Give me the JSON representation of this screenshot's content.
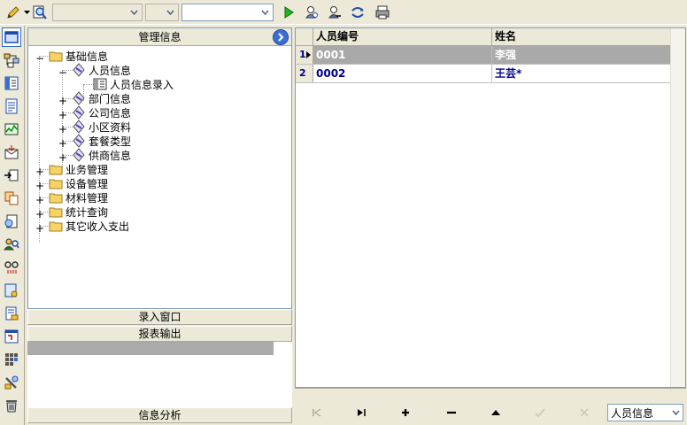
{
  "toolbar": {
    "buttons": [
      {
        "name": "pencil-edit-icon"
      },
      {
        "name": "find-magnifier-icon"
      },
      {
        "name": "run-play-icon"
      },
      {
        "name": "users-search-icon"
      },
      {
        "name": "user-filter-icon"
      },
      {
        "name": "refresh-swap-icon"
      },
      {
        "name": "printer-icon"
      }
    ],
    "combo1_value": "",
    "combo2_value": "",
    "combo3_value": ""
  },
  "tree_panel": {
    "title": "管理信息",
    "nodes": [
      {
        "label": "基础信息",
        "expanded": true,
        "level": 0,
        "icon": "folder-icon"
      },
      {
        "label": "人员信息",
        "expanded": true,
        "level": 1,
        "icon": "diamond-node-icon"
      },
      {
        "label": "人员信息录入",
        "level": 2,
        "icon": "form-icon"
      },
      {
        "label": "部门信息",
        "expanded": false,
        "level": 1,
        "icon": "diamond-node-icon"
      },
      {
        "label": "公司信息",
        "expanded": false,
        "level": 1,
        "icon": "diamond-node-icon"
      },
      {
        "label": "小区资料",
        "expanded": false,
        "level": 1,
        "icon": "diamond-node-icon"
      },
      {
        "label": "套餐类型",
        "expanded": false,
        "level": 1,
        "icon": "diamond-node-icon"
      },
      {
        "label": "供商信息",
        "expanded": false,
        "level": 1,
        "icon": "diamond-node-icon"
      },
      {
        "label": "业务管理",
        "expanded": false,
        "level": 0,
        "icon": "folder-icon"
      },
      {
        "label": "设备管理",
        "expanded": false,
        "level": 0,
        "icon": "folder-icon"
      },
      {
        "label": "材料管理",
        "expanded": false,
        "level": 0,
        "icon": "folder-icon"
      },
      {
        "label": "统计查询",
        "expanded": false,
        "level": 0,
        "icon": "folder-icon"
      },
      {
        "label": "其它收入支出",
        "expanded": false,
        "level": 0,
        "icon": "folder-icon"
      }
    ]
  },
  "outlook": {
    "bar1": "录入窗口",
    "bar2": "报表输出",
    "bar3": "信息分析"
  },
  "grid": {
    "columns": [
      "人员编号",
      "姓名"
    ],
    "rows": [
      {
        "num": "1",
        "id": "0001",
        "name": "李强"
      },
      {
        "num": "2",
        "id": "0002",
        "name": "王芸*"
      }
    ]
  },
  "navigator": {
    "buttons": [
      {
        "name": "nav-first-icon",
        "enabled": false
      },
      {
        "name": "nav-last-icon",
        "enabled": true
      },
      {
        "name": "nav-insert-icon",
        "enabled": true
      },
      {
        "name": "nav-delete-icon",
        "enabled": true
      },
      {
        "name": "nav-edit-icon",
        "enabled": true
      },
      {
        "name": "nav-post-icon",
        "enabled": false
      },
      {
        "name": "nav-cancel-icon",
        "enabled": false
      }
    ],
    "combo_value": "人员信息"
  },
  "colors": {
    "face": "#ece9d8",
    "border": "#7f9db9",
    "selected_row": "#a9a9a9",
    "cell_text": "#00008b"
  }
}
